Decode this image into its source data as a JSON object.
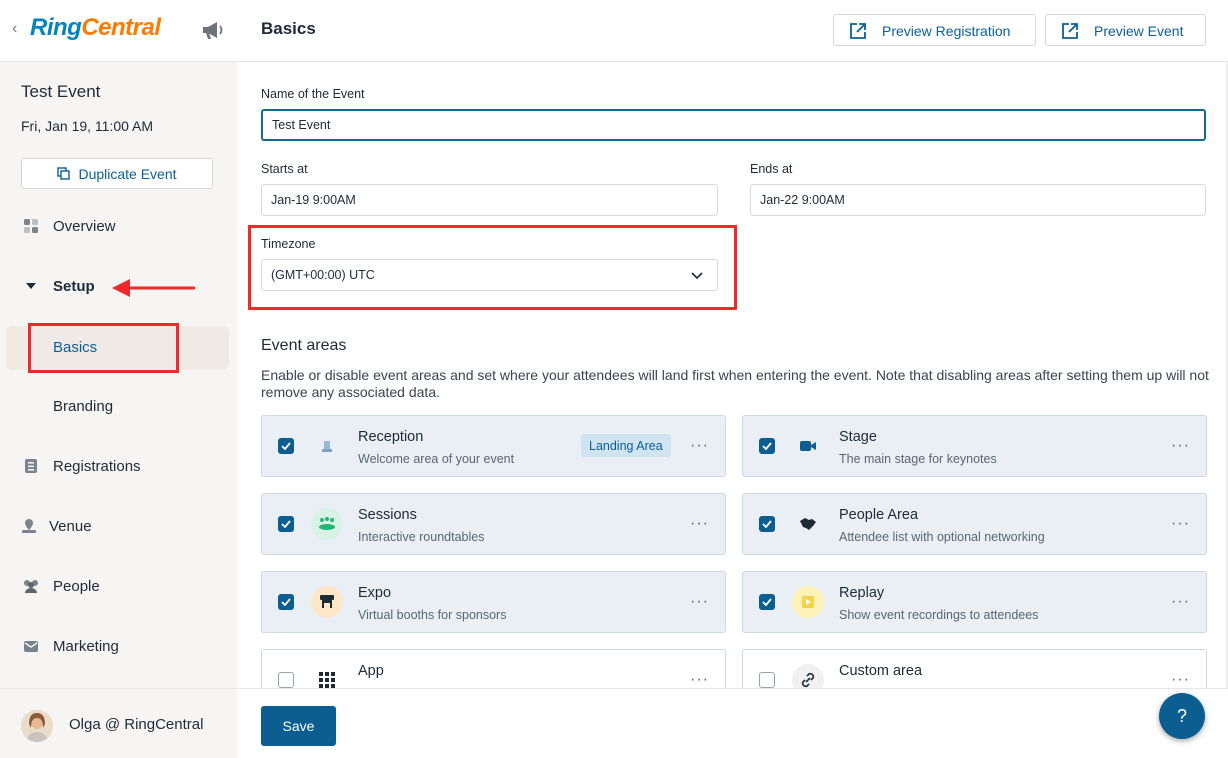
{
  "brand": {
    "ring": "Ring",
    "central": "Central",
    "accent": "#0b5e8f",
    "highlight": "#ee2a2a"
  },
  "sidebar": {
    "event_title": "Test Event",
    "event_date": "Fri, Jan 19, 11:00 AM",
    "duplicate_label": "Duplicate Event",
    "items": [
      {
        "label": "Overview",
        "icon": "overview-icon"
      },
      {
        "label": "Setup",
        "icon": "caret-down-icon"
      },
      {
        "label": "Basics"
      },
      {
        "label": "Branding"
      },
      {
        "label": "Registrations",
        "icon": "registrations-icon"
      },
      {
        "label": "Venue",
        "icon": "venue-icon"
      },
      {
        "label": "People",
        "icon": "people-icon"
      },
      {
        "label": "Marketing",
        "icon": "marketing-icon"
      }
    ],
    "user_name": "Olga @ RingCentral"
  },
  "header": {
    "title": "Basics",
    "preview_registration": "Preview Registration",
    "preview_event": "Preview Event"
  },
  "form": {
    "name_label": "Name of the Event",
    "name_value": "Test Event",
    "starts_label": "Starts at",
    "starts_value": "Jan-19 9:00AM",
    "ends_label": "Ends at",
    "ends_value": "Jan-22 9:00AM",
    "timezone_label": "Timezone",
    "timezone_value": "(GMT+00:00) UTC"
  },
  "areas": {
    "title": "Event areas",
    "description": "Enable or disable event areas and set where your attendees will land first when entering the event. Note that disabling areas after setting them up will not remove any associated data.",
    "landing_badge": "Landing Area",
    "cards": [
      {
        "title": "Reception",
        "subtitle": "Welcome area of your event",
        "checked": true
      },
      {
        "title": "Stage",
        "subtitle": "The main stage for keynotes",
        "checked": true
      },
      {
        "title": "Sessions",
        "subtitle": "Interactive roundtables",
        "checked": true
      },
      {
        "title": "People Area",
        "subtitle": "Attendee list with optional networking",
        "checked": true
      },
      {
        "title": "Expo",
        "subtitle": "Virtual booths for sponsors",
        "checked": true
      },
      {
        "title": "Replay",
        "subtitle": "Show event recordings to attendees",
        "checked": true
      },
      {
        "title": "App",
        "subtitle": "",
        "checked": false
      },
      {
        "title": "Custom area",
        "subtitle": "",
        "checked": false
      }
    ],
    "more_label": "···"
  },
  "footer": {
    "save_label": "Save",
    "help_label": "?"
  }
}
